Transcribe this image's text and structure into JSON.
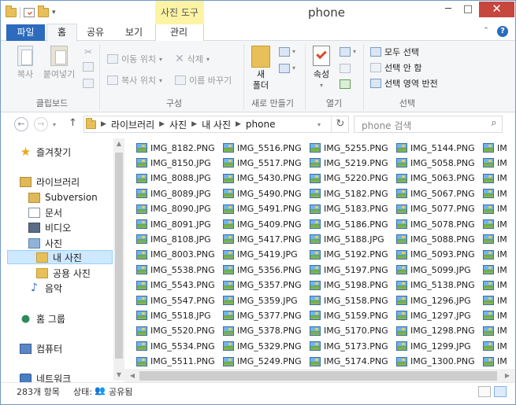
{
  "window": {
    "title": "phone",
    "context_tab": "사진 도구",
    "minimize": "─",
    "maximize": "□",
    "close": "✕"
  },
  "ribbon": {
    "tabs": {
      "file": "파일",
      "home": "홈",
      "share": "공유",
      "view": "보기",
      "manage": "관리"
    },
    "clipboard": {
      "copy": "복사",
      "paste": "붙여넣기",
      "label": "클립보드"
    },
    "organize": {
      "move_to": "이동 위치",
      "copy_to": "복사 위치",
      "delete": "삭제",
      "rename": "이름 바꾸기",
      "label": "구성"
    },
    "new": {
      "new_folder_line1": "새",
      "new_folder_line2": "폴더",
      "label": "새로 만들기"
    },
    "open": {
      "properties": "속성",
      "label": "열기"
    },
    "select": {
      "select_all": "모두 선택",
      "select_none": "선택 안 함",
      "invert": "선택 영역 반전",
      "label": "선택"
    }
  },
  "address": {
    "crumbs": [
      "라이브러리",
      "사진",
      "내 사진",
      "phone"
    ],
    "search_placeholder": "phone 검색"
  },
  "nav": {
    "favorites": "즐겨찾기",
    "libraries": "라이브러리",
    "subversion": "Subversion",
    "documents": "문서",
    "videos": "비디오",
    "pictures": "사진",
    "my_pictures": "내 사진",
    "public_pictures": "공용 사진",
    "music": "음악",
    "homegroup": "홈 그룹",
    "computer": "컴퓨터",
    "network": "네트워크"
  },
  "files": {
    "columns": [
      [
        "IMG_8182.PNG",
        "IMG_8150.JPG",
        "IMG_8088.JPG",
        "IMG_8089.JPG",
        "IMG_8090.JPG",
        "IMG_8091.JPG",
        "IMG_8108.JPG",
        "IMG_8003.PNG",
        "IMG_5538.PNG",
        "IMG_5543.PNG",
        "IMG_5547.PNG",
        "IMG_5518.JPG",
        "IMG_5520.PNG",
        "IMG_5534.PNG",
        "IMG_5511.PNG"
      ],
      [
        "IMG_5516.PNG",
        "IMG_5517.PNG",
        "IMG_5430.PNG",
        "IMG_5490.PNG",
        "IMG_5491.PNG",
        "IMG_5409.PNG",
        "IMG_5417.PNG",
        "IMG_5419.JPG",
        "IMG_5356.PNG",
        "IMG_5357.PNG",
        "IMG_5359.JPG",
        "IMG_5377.PNG",
        "IMG_5378.PNG",
        "IMG_5329.PNG",
        "IMG_5249.PNG"
      ],
      [
        "IMG_5255.PNG",
        "IMG_5219.PNG",
        "IMG_5220.PNG",
        "IMG_5182.PNG",
        "IMG_5183.PNG",
        "IMG_5186.PNG",
        "IMG_5188.JPG",
        "IMG_5192.PNG",
        "IMG_5197.PNG",
        "IMG_5198.PNG",
        "IMG_5158.PNG",
        "IMG_5159.PNG",
        "IMG_5170.PNG",
        "IMG_5173.PNG",
        "IMG_5174.PNG"
      ],
      [
        "IMG_5144.PNG",
        "IMG_5058.PNG",
        "IMG_5063.PNG",
        "IMG_5067.PNG",
        "IMG_5077.PNG",
        "IMG_5078.PNG",
        "IMG_5088.PNG",
        "IMG_5093.PNG",
        "IMG_5099.JPG",
        "IMG_5138.PNG",
        "IMG_1296.JPG",
        "IMG_1297.JPG",
        "IMG_1298.PNG",
        "IMG_1299.JPG",
        "IMG_1300.PNG"
      ],
      [
        "IM",
        "IM",
        "IM",
        "IM",
        "IM",
        "IM",
        "IM",
        "IM",
        "IM",
        "IM",
        "IM",
        "IM",
        "IM",
        "IM",
        "IM"
      ]
    ]
  },
  "status": {
    "count": "283개 항목",
    "state_label": "상태:",
    "state_value": "공유됨"
  }
}
